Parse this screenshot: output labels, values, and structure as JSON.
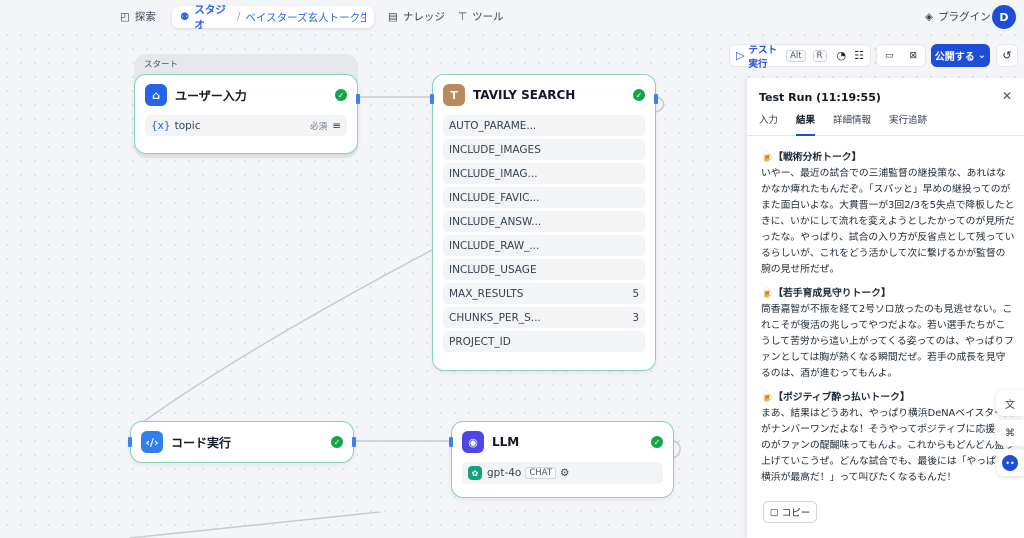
{
  "nav": {
    "explore": "探索",
    "studio": "スタジオ",
    "app_name": "ベイスターズ玄人トーク生...",
    "knowledge": "ナレッジ",
    "tools": "ツール",
    "plugins": "プラグイン",
    "avatar": "D"
  },
  "toolbar": {
    "test_run": "テスト実行",
    "kbd_alt": "Alt",
    "kbd_r": "R",
    "publish": "公開する"
  },
  "start_label": "スタート",
  "nodes": {
    "user_input": {
      "title": "ユーザー入力",
      "field": "topic",
      "badge": "必須"
    },
    "tavily": {
      "title": "TAVILY SEARCH",
      "fields": [
        {
          "name": "AUTO_PARAME...",
          "value": ""
        },
        {
          "name": "INCLUDE_IMAGES",
          "value": ""
        },
        {
          "name": "INCLUDE_IMAG...",
          "value": ""
        },
        {
          "name": "INCLUDE_FAVIC...",
          "value": ""
        },
        {
          "name": "INCLUDE_ANSW...",
          "value": ""
        },
        {
          "name": "INCLUDE_RAW_...",
          "value": ""
        },
        {
          "name": "INCLUDE_USAGE",
          "value": ""
        },
        {
          "name": "MAX_RESULTS",
          "value": "5"
        },
        {
          "name": "CHUNKS_PER_S...",
          "value": "3"
        },
        {
          "name": "PROJECT_ID",
          "value": ""
        }
      ]
    },
    "code": {
      "title": "コード実行"
    },
    "llm": {
      "title": "LLM",
      "model": "gpt-4o",
      "mode": "CHAT"
    }
  },
  "panel": {
    "title": "Test Run (11:19:55)",
    "tabs": [
      "入力",
      "結果",
      "詳細情報",
      "実行追跡"
    ],
    "sections": [
      {
        "heading": "🍺【戦術分析トーク】",
        "body": "いやー、最近の試合での三浦監督の継投策な、あれはなかなか痺れたもんだぞ。「スパッと」早めの継投ってのがまた面白いよな。大貫晋一が3回2/3を5失点で降板したときに、いかにして流れを変えようとしたかってのが見所だったな。やっぱり、試合の入り方が反省点として残っているらしいが、これをどう活かして次に繋げるかが監督の腕の見せ所だぜ。"
      },
      {
        "heading": "🍺【若手育成見守りトーク】",
        "body": "筒香嘉智が不振を経て2号ソロ放ったのも見逃せない。これこそが復活の兆しってやつだよな。若い選手たちがこうして苦労から這い上がってくる姿ってのは、やっぱりファンとしては胸が熱くなる瞬間だぜ。若手の成長を見守るのは、酒が進むってもんよ。"
      },
      {
        "heading": "🍺【ポジティブ酔っ払いトーク】",
        "body": "まあ、結果はどうあれ、やっぱり横浜DeNAベイスターズがナンバーワンだよな！そうやってポジティブに応援するのがファンの醍醐味ってもんよ。これからもどんどん盛り上げていこうぜ。どんな試合でも、最後には「やっぱり横浜が最高だ！」って叫びたくなるもんだ！"
      }
    ],
    "copy": "コピー"
  },
  "colors": {
    "accent": "#1d4ed8",
    "node_border": "#86d3b5",
    "success": "#16a34a"
  }
}
